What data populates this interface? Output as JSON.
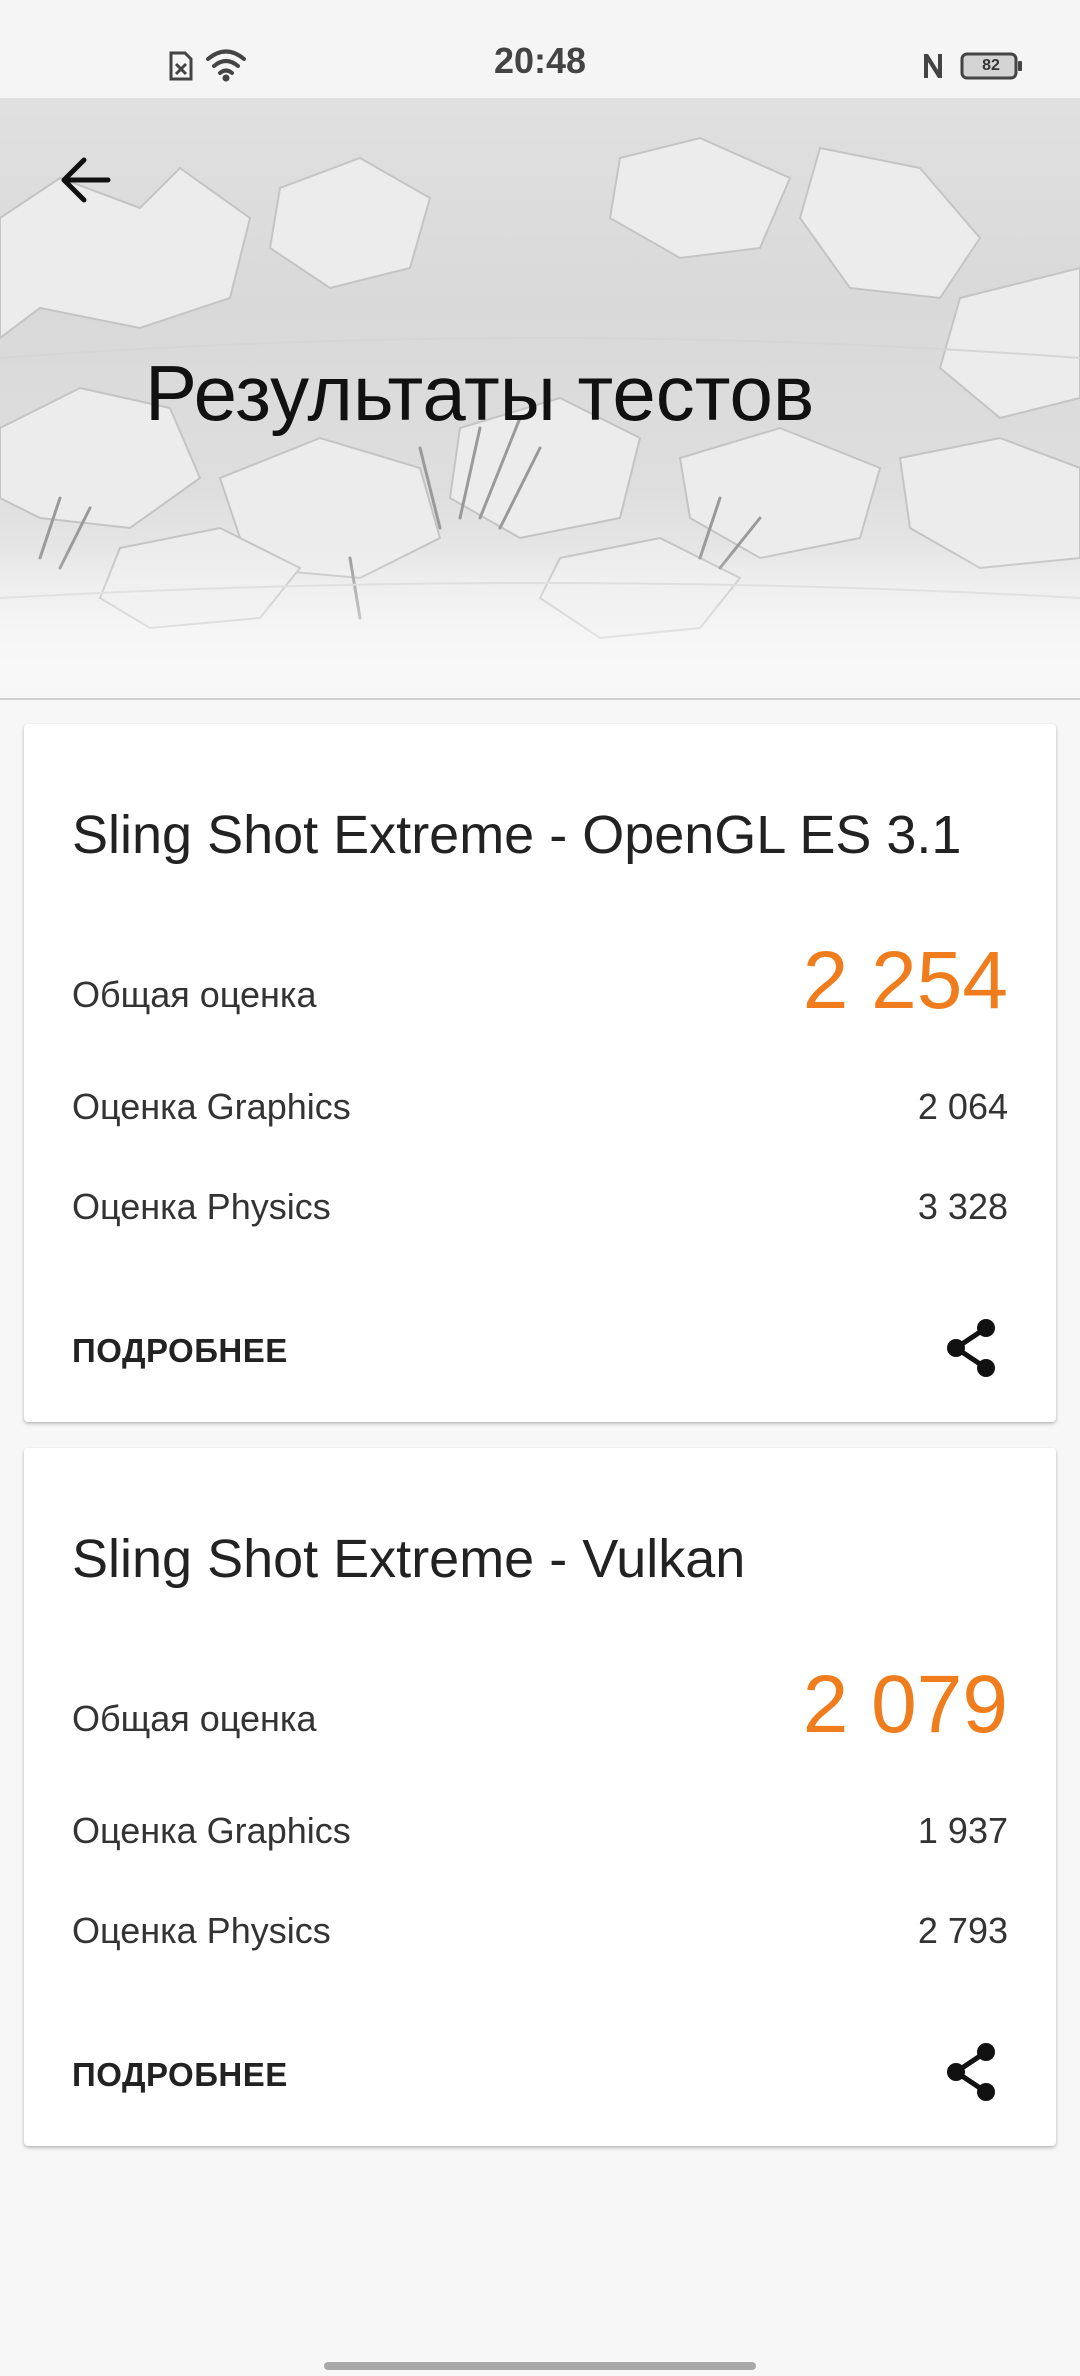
{
  "status_bar": {
    "time": "20:48",
    "battery_level": "82",
    "icons": [
      "sim-missing-icon",
      "wifi-icon",
      "nfc-icon",
      "battery-icon"
    ]
  },
  "header": {
    "title": "Результаты тестов",
    "back_icon": "arrow-back-icon"
  },
  "results": [
    {
      "title": "Sling Shot Extreme - OpenGL ES 3.1",
      "overall_label": "Общая оценка",
      "overall_value": "2 254",
      "graphics_label": "Оценка Graphics",
      "graphics_value": "2 064",
      "physics_label": "Оценка Physics",
      "physics_value": "3 328",
      "details_label": "ПОДРОБНЕЕ",
      "share_icon": "share-icon"
    },
    {
      "title": "Sling Shot Extreme - Vulkan",
      "overall_label": "Общая оценка",
      "overall_value": "2 079",
      "graphics_label": "Оценка Graphics",
      "graphics_value": "1 937",
      "physics_label": "Оценка Physics",
      "physics_value": "2 793",
      "details_label": "ПОДРОБНЕЕ",
      "share_icon": "share-icon"
    }
  ],
  "colors": {
    "accent": "#f07d1d",
    "background": "#f7f7f7",
    "card": "#ffffff"
  }
}
